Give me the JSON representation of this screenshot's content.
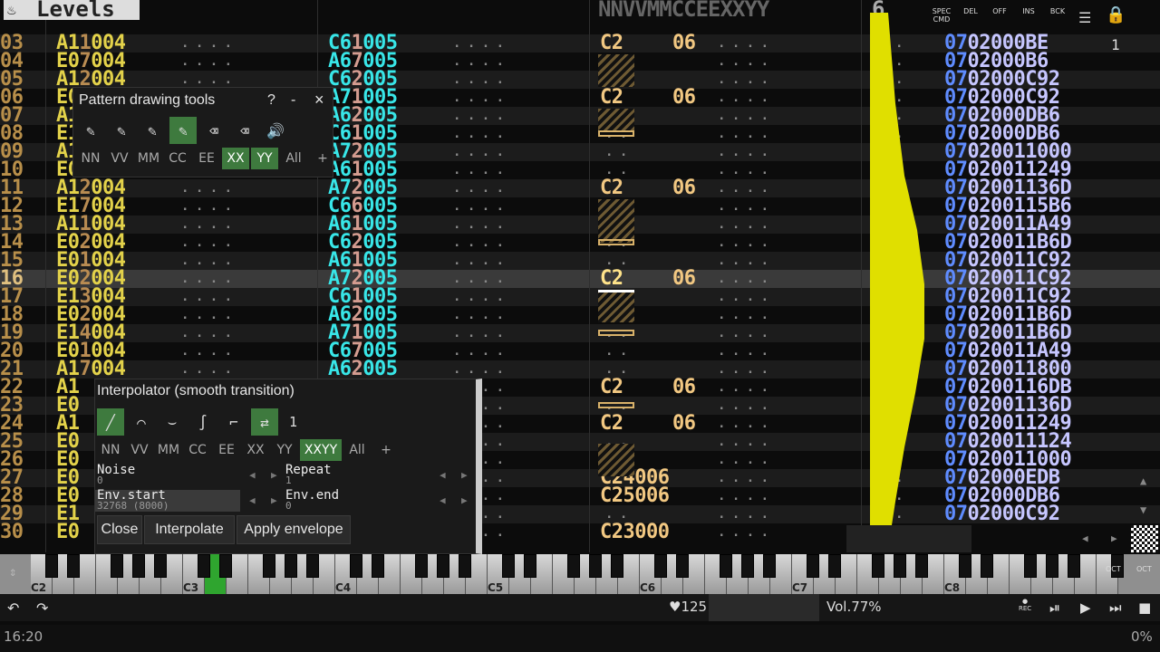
{
  "app": {
    "title": "Levels",
    "track_number": "6",
    "right_counter": "1"
  },
  "header": {
    "pattern_cols": "NNVVMMCCEEXXYY"
  },
  "top_icons": [
    {
      "label": "SPEC\nCMD",
      "icon": "spec-cmd-icon"
    },
    {
      "label": "DEL",
      "icon": "delete-icon"
    },
    {
      "label": "OFF",
      "icon": "off-icon"
    },
    {
      "label": "INS",
      "icon": "insert-icon"
    },
    {
      "label": "BCK",
      "icon": "backspace-icon"
    }
  ],
  "rows": [
    {
      "n": "03",
      "lv": "A11004",
      "cyan": "C61005",
      "np": "C2",
      "vol": "06"
    },
    {
      "n": "04",
      "lv": "E07004",
      "cyan": "A67005",
      "np": "",
      "vol": ""
    },
    {
      "n": "05",
      "lv": "A12004",
      "cyan": "C62005",
      "np": "",
      "vol": ""
    },
    {
      "n": "06",
      "lv": "E0 004",
      "cyan": "A71005",
      "np": "C2",
      "vol": "06"
    },
    {
      "n": "07",
      "lv": "A1 004",
      "cyan": "A62005",
      "np": "",
      "vol": ""
    },
    {
      "n": "08",
      "lv": "E1 004",
      "cyan": "C61005",
      "np": "",
      "vol": ""
    },
    {
      "n": "09",
      "lv": "A1 004",
      "cyan": "A72005",
      "np": "",
      "vol": ""
    },
    {
      "n": "10",
      "lv": "E0 004",
      "cyan": "A61005",
      "np": "",
      "vol": ""
    },
    {
      "n": "11",
      "lv": "A12004",
      "cyan": "A72005",
      "np": "C2",
      "vol": "06"
    },
    {
      "n": "12",
      "lv": "E17004",
      "cyan": "C66005",
      "np": "",
      "vol": ""
    },
    {
      "n": "13",
      "lv": "A11004",
      "cyan": "A61005",
      "np": "",
      "vol": ""
    },
    {
      "n": "14",
      "lv": "E02004",
      "cyan": "C62005",
      "np": "",
      "vol": ""
    },
    {
      "n": "15",
      "lv": "E01004",
      "cyan": "A61005",
      "np": "",
      "vol": ""
    },
    {
      "n": "16",
      "lv": "E02004",
      "cyan": "A72005",
      "np": "C2",
      "vol": "06"
    },
    {
      "n": "17",
      "lv": "E13004",
      "cyan": "C61005",
      "np": "",
      "vol": ""
    },
    {
      "n": "18",
      "lv": "E02004",
      "cyan": "A62005",
      "np": "",
      "vol": ""
    },
    {
      "n": "19",
      "lv": "E14004",
      "cyan": "A71005",
      "np": "",
      "vol": ""
    },
    {
      "n": "20",
      "lv": "E01004",
      "cyan": "C67005",
      "np": "",
      "vol": ""
    },
    {
      "n": "21",
      "lv": "A17004",
      "cyan": "A62005",
      "np": "",
      "vol": ""
    },
    {
      "n": "22",
      "lv": "A1",
      "cyan": "",
      "np": "C2",
      "vol": "06"
    },
    {
      "n": "23",
      "lv": "E0",
      "cyan": "",
      "np": "",
      "vol": ""
    },
    {
      "n": "24",
      "lv": "A1",
      "cyan": "",
      "np": "C2",
      "vol": "06"
    },
    {
      "n": "25",
      "lv": "E0",
      "cyan": "",
      "np": "",
      "vol": ""
    },
    {
      "n": "26",
      "lv": "E0",
      "cyan": "",
      "np": "",
      "vol": ""
    },
    {
      "n": "27",
      "lv": "E0",
      "cyan": "",
      "np": "C24006",
      "vol": ""
    },
    {
      "n": "28",
      "lv": "E0",
      "cyan": "",
      "np": "C25006",
      "vol": ""
    },
    {
      "n": "29",
      "lv": "E1",
      "cyan": "",
      "np": "",
      "vol": ""
    },
    {
      "n": "30",
      "lv": "E0",
      "cyan": "",
      "np": "C23000",
      "vol": ""
    }
  ],
  "hex_rows": [
    "0702000BE",
    "0702000B6",
    "0702000C92",
    "0702000C92",
    "0702000DB6",
    "0702000DB6",
    "07020011000",
    "07020011249",
    "0702001136D",
    "070200115B6",
    "07020011A49",
    "07020011B6D",
    "07020011C92",
    "07020011C92",
    "07020011C92",
    "07020011B6D",
    "07020011B6D",
    "07020011A49",
    "07020011800",
    "070200116DB",
    "0702001136D",
    "07020011249",
    "07020011124",
    "07020011000",
    "0702000EDB",
    "0702000DB6",
    "0702000C92"
  ],
  "drawing_tools": {
    "title": "Pattern drawing tools",
    "help": "?",
    "minimize": "-",
    "close": "×",
    "tools": [
      {
        "icon": "pencil-icon",
        "on": false
      },
      {
        "icon": "pencil-off-icon",
        "on": false
      },
      {
        "icon": "pencil-vv-icon",
        "on": false
      },
      {
        "icon": "pencil-xy-icon",
        "on": true
      },
      {
        "icon": "eraser-icon",
        "on": false
      },
      {
        "icon": "eraser-all-icon",
        "on": false
      },
      {
        "icon": "speaker-icon",
        "on": false
      }
    ],
    "chips": [
      {
        "label": "NN",
        "on": false
      },
      {
        "label": "VV",
        "on": false
      },
      {
        "label": "MM",
        "on": false
      },
      {
        "label": "CC",
        "on": false
      },
      {
        "label": "EE",
        "on": false
      },
      {
        "label": "XX",
        "on": true
      },
      {
        "label": "YY",
        "on": true
      },
      {
        "label": "All",
        "on": false
      },
      {
        "label": "+",
        "on": false
      }
    ]
  },
  "interpolator": {
    "title": "Interpolator (smooth transition)",
    "curve_count": "1",
    "curves": [
      {
        "icon": "linear-curve-icon",
        "on": true
      },
      {
        "icon": "ease-out-curve-icon",
        "on": false
      },
      {
        "icon": "ease-in-curve-icon",
        "on": false
      },
      {
        "icon": "s-curve-icon",
        "on": false
      },
      {
        "icon": "step-curve-icon",
        "on": false
      },
      {
        "icon": "swap-icon",
        "on": true
      }
    ],
    "chips": [
      {
        "label": "NN",
        "on": false
      },
      {
        "label": "VV",
        "on": false
      },
      {
        "label": "MM",
        "on": false
      },
      {
        "label": "CC",
        "on": false
      },
      {
        "label": "EE",
        "on": false
      },
      {
        "label": "XX",
        "on": false
      },
      {
        "label": "YY",
        "on": false
      },
      {
        "label": "XXYY",
        "on": true
      },
      {
        "label": "All",
        "on": false
      },
      {
        "label": "+",
        "on": false
      }
    ],
    "noise_label": "Noise",
    "noise_value": "0",
    "repeat_label": "Repeat",
    "repeat_value": "1",
    "env_start_label": "Env.start",
    "env_start_value": "32768 (8000)",
    "env_end_label": "Env.end",
    "env_end_value": "0",
    "close": "Close",
    "interpolate": "Interpolate",
    "apply": "Apply envelope"
  },
  "piano": {
    "octaves": [
      "C2",
      "C3",
      "C4",
      "C5",
      "C6",
      "C7",
      "C8"
    ],
    "oct_down": "OCT",
    "oct_up": "OCT"
  },
  "status": {
    "bpm": "♥125",
    "volume": "Vol.77%",
    "rec": "REC",
    "time": "16:20",
    "cpu": "0%"
  }
}
